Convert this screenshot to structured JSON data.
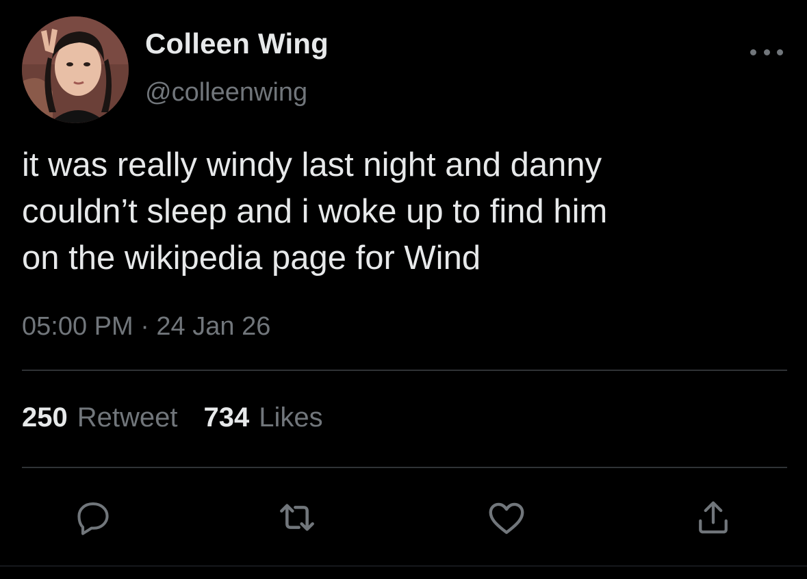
{
  "tweet": {
    "display_name": "Colleen Wing",
    "handle": "@colleenwing",
    "text": "it was really windy last night and danny\ncouldn’t sleep and i woke up to find him\non the wikipedia page for Wind",
    "timestamp": "05:00 PM · 24 Jan 26"
  },
  "stats": {
    "retweets_count": "250",
    "retweets_label": "Retweet",
    "likes_count": "734",
    "likes_label": "Likes"
  },
  "actions": {
    "reply_icon": "reply-icon",
    "retweet_icon": "retweet-icon",
    "like_icon": "heart-icon",
    "share_icon": "share-icon"
  },
  "colors": {
    "background": "#000000",
    "primary_text": "#e7e9ea",
    "secondary_text": "#71767b",
    "divider": "#2f3336"
  }
}
